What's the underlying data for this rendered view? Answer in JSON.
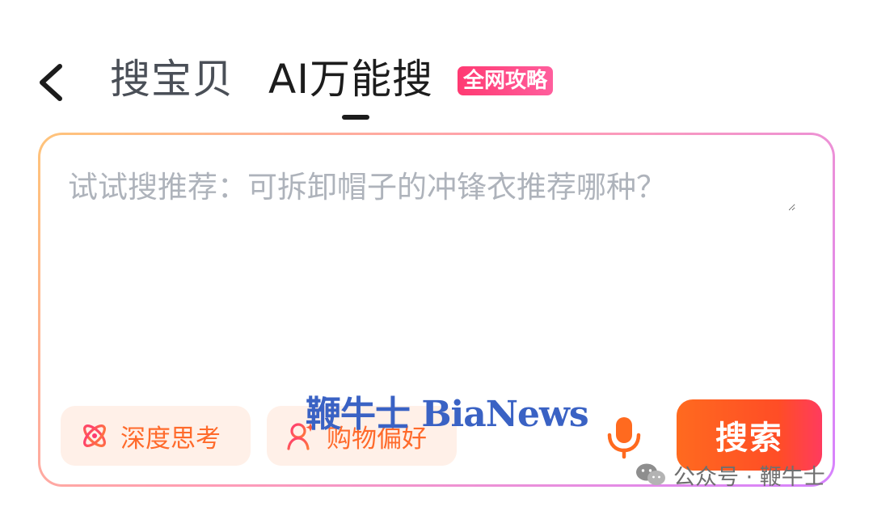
{
  "header": {
    "back_icon": "chevron-left-icon",
    "tabs": [
      {
        "label": "搜宝贝",
        "active": false
      },
      {
        "label": "AI万能搜",
        "active": true
      }
    ],
    "badge": "全网攻略"
  },
  "search": {
    "placeholder": "试试搜推荐：可拆卸帽子的冲锋衣推荐哪种？",
    "chips": [
      {
        "label": "深度思考",
        "icon": "atom-icon"
      },
      {
        "label": "购物偏好",
        "icon": "user-sparkle-icon"
      }
    ],
    "mic_icon": "microphone-icon",
    "submit_label": "搜索"
  },
  "watermarks": {
    "site": "鞭牛士 BiaNews",
    "wechat": "公众号 · 鞭牛士"
  },
  "colors": {
    "accent_orange": "#ff5a1f",
    "badge_pink": "#ff3a72",
    "chip_bg": "#fff0e8",
    "placeholder_gray": "#aeb3bb",
    "watermark_blue": "#3a62c4"
  }
}
